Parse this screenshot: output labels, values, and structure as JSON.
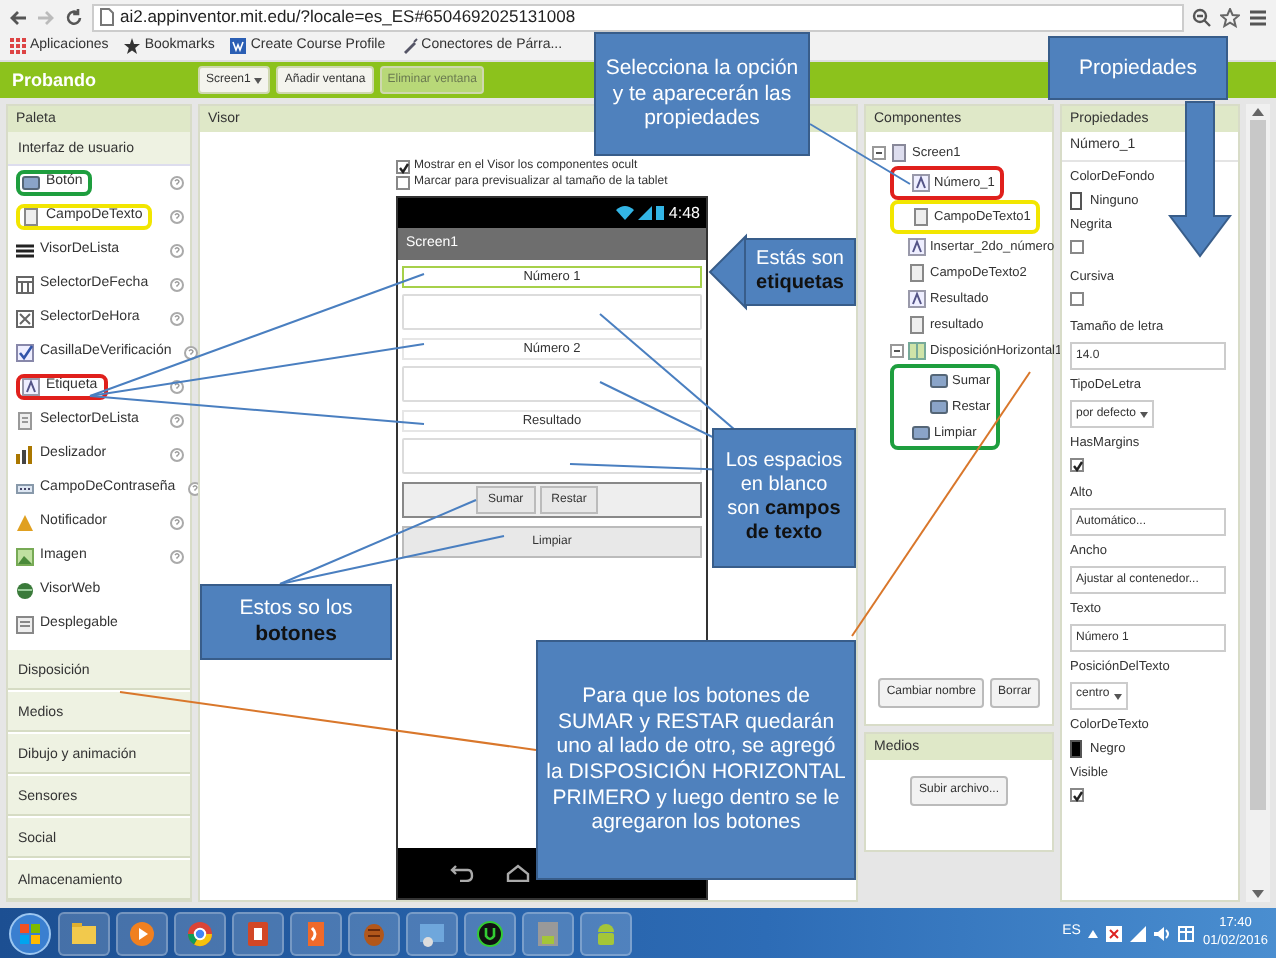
{
  "browser": {
    "url": "ai2.appinventor.mit.edu/?locale=es_ES#6504692025131008",
    "bookmarks": [
      "Aplicaciones",
      "Bookmarks",
      "Create Course Profile",
      "Conectores de Párra..."
    ]
  },
  "app_bar": {
    "project": "Probando",
    "screen_dropdown": "Screen1",
    "buttons": [
      {
        "label": "Añadir ventana",
        "disabled": false
      },
      {
        "label": "Eliminar ventana",
        "disabled": true
      }
    ]
  },
  "palette": {
    "title": "Paleta",
    "category": "Interfaz de usuario",
    "items": [
      {
        "label": "Botón",
        "help": true,
        "color": "#1e9e3e"
      },
      {
        "label": "CampoDeTexto",
        "help": true,
        "color": "#f2e600"
      },
      {
        "label": "VisorDeLista",
        "help": true
      },
      {
        "label": "SelectorDeFecha",
        "help": true
      },
      {
        "label": "SelectorDeHora",
        "help": true
      },
      {
        "label": "CasillaDeVerificación",
        "help": true
      },
      {
        "label": "Etiqueta",
        "help": true,
        "color": "#e0201c"
      },
      {
        "label": "SelectorDeLista",
        "help": true
      },
      {
        "label": "Deslizador",
        "help": true
      },
      {
        "label": "CampoDeContraseña",
        "help": true
      },
      {
        "label": "Notificador",
        "help": true
      },
      {
        "label": "Imagen",
        "help": true
      },
      {
        "label": "VisorWeb",
        "help": false
      },
      {
        "label": "Desplegable",
        "help": false
      }
    ],
    "sections": [
      "Disposición",
      "Medios",
      "Dibujo y animación",
      "Sensores",
      "Social",
      "Almacenamiento"
    ]
  },
  "viewer": {
    "title": "Visor",
    "options": [
      {
        "label": "Mostrar en el Visor los componentes ocult",
        "checked": true
      },
      {
        "label": "Marcar para previsualizar al tamaño de la tablet",
        "checked": false
      }
    ],
    "phone": {
      "time": "4:48",
      "screen_title": "Screen1",
      "components": [
        {
          "kind": "label",
          "text": "Número 1",
          "selected": true
        },
        {
          "kind": "textbox"
        },
        {
          "kind": "label",
          "text": "Número 2",
          "selected": false
        },
        {
          "kind": "textbox"
        },
        {
          "kind": "label",
          "text": "Resultado",
          "selected": false
        },
        {
          "kind": "textbox"
        },
        {
          "kind": "row",
          "buttons": [
            "Sumar",
            "Restar"
          ]
        },
        {
          "kind": "button",
          "text": "Limpiar"
        }
      ]
    }
  },
  "components": {
    "title": "Componentes",
    "tree": [
      {
        "label": "Screen1",
        "kind": "screen",
        "expanded": true,
        "children": [
          {
            "label": "Número_1",
            "kind": "label",
            "color": "#e0201c"
          },
          {
            "label": "CampoDeTexto1",
            "kind": "textbox",
            "color": "#f2e600"
          },
          {
            "label": "Insertar_2do_número",
            "kind": "label"
          },
          {
            "label": "CampoDeTexto2",
            "kind": "textbox"
          },
          {
            "label": "Resultado",
            "kind": "label"
          },
          {
            "label": "resultado",
            "kind": "textbox"
          },
          {
            "label": "DisposiciónHorizontal1",
            "kind": "arrangement",
            "expanded": true,
            "children": [
              {
                "label": "Sumar",
                "kind": "button",
                "color": "#1e9e3e"
              },
              {
                "label": "Restar",
                "kind": "button",
                "color": "#1e9e3e"
              }
            ]
          },
          {
            "label": "Limpiar",
            "kind": "button",
            "color": "#1e9e3e"
          }
        ]
      }
    ],
    "buttons": [
      "Cambiar nombre",
      "Borrar"
    ]
  },
  "media": {
    "title": "Medios",
    "button": "Subir archivo..."
  },
  "properties": {
    "title": "Propiedades",
    "component": "Número_1",
    "items": [
      {
        "name": "ColorDeFondo",
        "kind": "color",
        "value": "Ninguno",
        "color": "#ffffff"
      },
      {
        "name": "Negrita",
        "kind": "checkbox",
        "checked": false
      },
      {
        "name": "Cursiva",
        "kind": "checkbox",
        "checked": false
      },
      {
        "name": "Tamaño de letra",
        "kind": "text",
        "value": "14.0"
      },
      {
        "name": "TipoDeLetra",
        "kind": "dropdown",
        "value": "por defecto"
      },
      {
        "name": "HasMargins",
        "kind": "checkbox",
        "checked": true
      },
      {
        "name": "Alto",
        "kind": "text",
        "value": "Automático..."
      },
      {
        "name": "Ancho",
        "kind": "text",
        "value": "Ajustar al contenedor..."
      },
      {
        "name": "Texto",
        "kind": "text",
        "value": "Número 1"
      },
      {
        "name": "PosiciónDelTexto",
        "kind": "dropdown",
        "value": "centro"
      },
      {
        "name": "ColorDeTexto",
        "kind": "color",
        "value": "Negro",
        "color": "#000000"
      },
      {
        "name": "Visible",
        "kind": "checkbox",
        "checked": true
      }
    ]
  },
  "taskbar": {
    "language": "ES",
    "time": "17:40",
    "date": "01/02/2016"
  },
  "annotations": [
    {
      "text": "Selecciona la opción y te aparecerán las propiedades"
    },
    {
      "text": "Propiedades"
    },
    {
      "text": "Estás son **etiquetas**"
    },
    {
      "text": "Los espacios en blanco son **campos de texto**"
    },
    {
      "text": "Estos so los **botones**"
    },
    {
      "text": "Para que los botones de SUMAR y RESTAR quedarán uno al lado de otro, se agregó la DISPOSICIÓN HORIZONTAL PRIMERO y luego dentro se le agregaron los botones"
    }
  ]
}
